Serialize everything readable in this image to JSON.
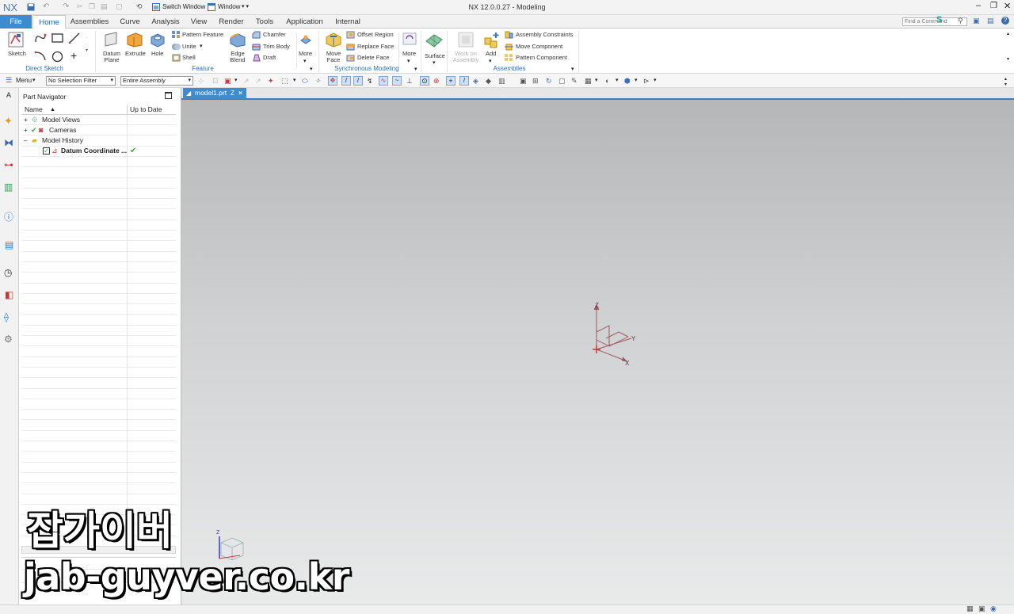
{
  "window": {
    "title": "NX 12.0.0.27 - Modeling",
    "logo": "NX",
    "switch_window": "Switch Window",
    "window_menu": "Window"
  },
  "tabs": [
    "File",
    "Home",
    "Assemblies",
    "Curve",
    "Analysis",
    "View",
    "Render",
    "Tools",
    "Application",
    "Internal"
  ],
  "search": {
    "placeholder": "Find a Command"
  },
  "ribbon": {
    "sketch": "Sketch",
    "direct_sketch": "Direct Sketch",
    "datum_plane": "Datum Plane",
    "extrude": "Extrude",
    "hole": "Hole",
    "pattern_feature": "Pattern Feature",
    "unite": "Unite",
    "shell": "Shell",
    "edge_blend": "Edge Blend",
    "chamfer": "Chamfer",
    "trim_body": "Trim Body",
    "draft": "Draft",
    "more": "More",
    "feature": "Feature",
    "move_face": "Move Face",
    "offset_region": "Offset Region",
    "replace_face": "Replace Face",
    "delete_face": "Delete Face",
    "synchronous_modeling": "Synchronous Modeling",
    "surface": "Surface",
    "work_on_assembly": "Work on Assembly",
    "add": "Add",
    "assembly_constraints": "Assembly Constraints",
    "move_component": "Move Component",
    "pattern_component": "Pattern Component",
    "assemblies": "Assemblies"
  },
  "selbar": {
    "menu": "Menu",
    "filter": "No Selection Filter",
    "scope": "Entire Assembly"
  },
  "navigator": {
    "title": "Part Navigator",
    "col_name": "Name",
    "col_uptodate": "Up to Date",
    "items": [
      "Model Views",
      "Cameras",
      "Model History",
      "Datum Coordinate ..."
    ]
  },
  "document": {
    "tab": "model1.prt"
  },
  "axes": {
    "z": "Z",
    "y": "Y",
    "x": "X"
  },
  "watermark": {
    "line1": "잡가이버",
    "line2": "jab-guyver.co.kr"
  },
  "colors": {
    "accent": "#3d8bd1",
    "check": "#2fae2f"
  }
}
